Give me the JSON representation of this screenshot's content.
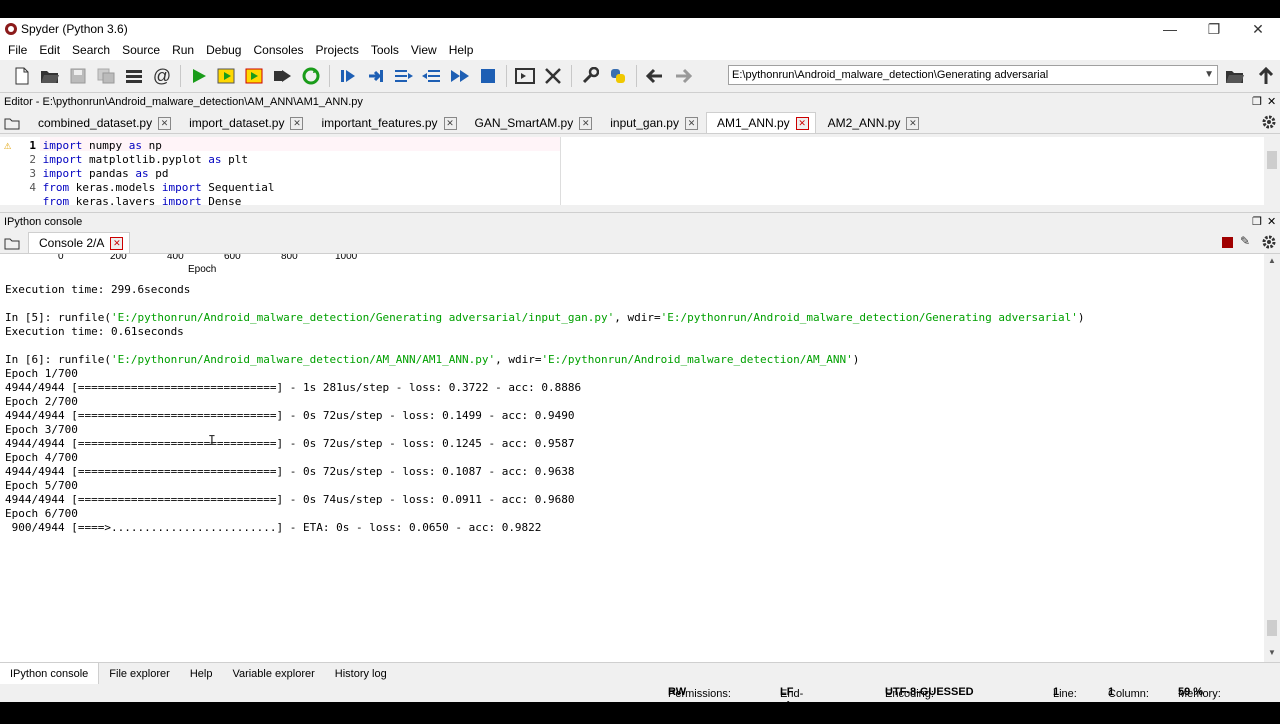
{
  "window": {
    "title": "Spyder (Python 3.6)"
  },
  "menu": [
    "File",
    "Edit",
    "Search",
    "Source",
    "Run",
    "Debug",
    "Consoles",
    "Projects",
    "Tools",
    "View",
    "Help"
  ],
  "toolbar": {
    "path": "E:\\pythonrun\\Android_malware_detection\\Generating adversarial"
  },
  "editor": {
    "title": "Editor - E:\\pythonrun\\Android_malware_detection\\AM_ANN\\AM1_ANN.py",
    "tabs": [
      "combined_dataset.py",
      "import_dataset.py",
      "important_features.py",
      "GAN_SmartAM.py",
      "input_gan.py",
      "AM1_ANN.py",
      "AM2_ANN.py"
    ],
    "active_tab": "AM1_ANN.py",
    "lines": [
      {
        "n": "1",
        "kw1": "import",
        "mid": " numpy ",
        "kw2": "as",
        "rest": " np"
      },
      {
        "n": "2",
        "kw1": "import",
        "mid": " matplotlib.pyplot ",
        "kw2": "as",
        "rest": " plt"
      },
      {
        "n": "3",
        "kw1": "import",
        "mid": " pandas ",
        "kw2": "as",
        "rest": " pd"
      },
      {
        "n": "4",
        "kw1": "from",
        "mid": " keras.models ",
        "kw2": "import",
        "rest": " Sequential"
      },
      {
        "n": "",
        "kw1": "from",
        "mid": " keras.layers ",
        "kw2": "import",
        "rest": " Dense"
      }
    ]
  },
  "console": {
    "title": "IPython console",
    "tab": "Console 2/A",
    "axis_ticks": [
      "0",
      "200",
      "400",
      "600",
      "800",
      "1000"
    ],
    "axis_label": "Epoch",
    "exec1": "Execution time: 299.6seconds",
    "in5_prefix": "In [5]: runfile(",
    "in5_path": "'E:/pythonrun/Android_malware_detection/Generating adversarial/input_gan.py'",
    "in5_mid": ", wdir=",
    "in5_wdir": "'E:/pythonrun/Android_malware_detection/Generating adversarial'",
    "in5_end": ")",
    "exec2": "Execution time: 0.61seconds",
    "in6_prefix": "In [6]: runfile(",
    "in6_path": "'E:/pythonrun/Android_malware_detection/AM_ANN/AM1_ANN.py'",
    "in6_mid": ", wdir=",
    "in6_wdir": "'E:/pythonrun/Android_malware_detection/AM_ANN'",
    "in6_end": ")",
    "log": [
      "Epoch 1/700",
      "4944/4944 [==============================] - 1s 281us/step - loss: 0.3722 - acc: 0.8886",
      "Epoch 2/700",
      "4944/4944 [==============================] - 0s 72us/step - loss: 0.1499 - acc: 0.9490",
      "Epoch 3/700",
      "4944/4944 [==============================] - 0s 72us/step - loss: 0.1245 - acc: 0.9587",
      "Epoch 4/700",
      "4944/4944 [==============================] - 0s 72us/step - loss: 0.1087 - acc: 0.9638",
      "Epoch 5/700",
      "4944/4944 [==============================] - 0s 74us/step - loss: 0.0911 - acc: 0.9680",
      "Epoch 6/700",
      " 900/4944 [====>.........................] - ETA: 0s - loss: 0.0650 - acc: 0.9822"
    ]
  },
  "bottom_tabs": [
    "IPython console",
    "File explorer",
    "Help",
    "Variable explorer",
    "History log"
  ],
  "status": {
    "permissions_label": "Permissions:",
    "permissions": "RW",
    "eol_label": "End-of-lines:",
    "eol": "LF",
    "encoding_label": "Encoding:",
    "encoding": "UTF-8-GUESSED",
    "line_label": "Line:",
    "line": "1",
    "column_label": "Column:",
    "column": "1",
    "memory_label": "Memory:",
    "memory": "59 %"
  }
}
